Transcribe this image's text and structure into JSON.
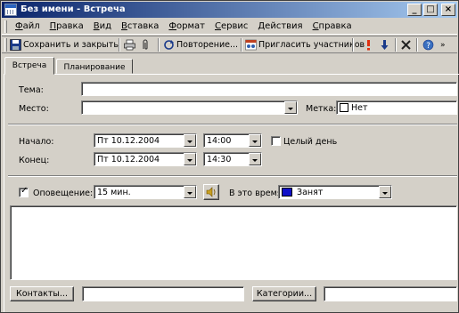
{
  "window": {
    "title": "Без имени - Встреча"
  },
  "titlebar_buttons": {
    "minimize": "_",
    "maximize": "□",
    "close": "×"
  },
  "menu": [
    {
      "label": "Файл",
      "accel": "Ф",
      "rest": "айл"
    },
    {
      "label": "Правка",
      "accel": "П",
      "rest": "равка"
    },
    {
      "label": "Вид",
      "accel": "В",
      "rest": "ид"
    },
    {
      "label": "Вставка",
      "accel": "В",
      "rest": "ставка"
    },
    {
      "label": "Формат",
      "accel": "Ф",
      "rest": "ормат"
    },
    {
      "label": "Сервис",
      "accel": "С",
      "rest": "ервис"
    },
    {
      "label": "Действия",
      "accel": "Д",
      "rest": "ействия"
    },
    {
      "label": "Справка",
      "accel": "С",
      "rest": "правка"
    }
  ],
  "toolbar": {
    "save_close": "Сохранить и закрыть",
    "repeat": "Повторение...",
    "invite": "Пригласить участников"
  },
  "tabs": [
    "Встреча",
    "Планирование"
  ],
  "form": {
    "subject_label": "Тема:",
    "subject_value": "",
    "location_label": "Место:",
    "location_value": "",
    "tag_label": "Метка:",
    "tag_value": "Нет",
    "start_label": "Начало:",
    "start_date": "Пт 10.12.2004",
    "start_time": "14:00",
    "allday_label": "Целый день",
    "end_label": "Конец:",
    "end_date": "Пт 10.12.2004",
    "end_time": "14:30",
    "reminder_label": "Оповещение:",
    "reminder_value": "15 мин.",
    "showas_label": "В это время:",
    "showas_value": "Занят",
    "contacts_button": "Контакты...",
    "categories_button": "Категории..."
  },
  "colors": {
    "title_start": "#0a246a",
    "title_end": "#a6caf0",
    "busy": "#1010c8"
  }
}
